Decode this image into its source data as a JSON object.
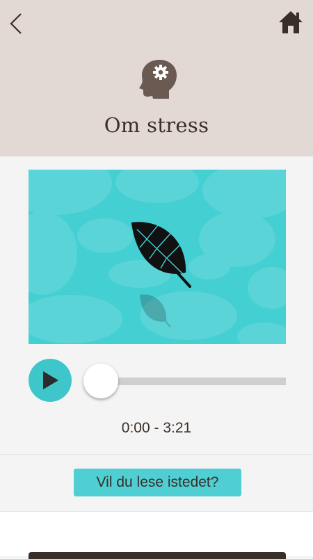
{
  "header": {
    "title": "Om stress",
    "back_icon": "chevron-left-icon",
    "home_icon": "home-icon",
    "topic_icon": "head-gear-icon",
    "background_color": "#e2d9d5"
  },
  "player": {
    "current_time": "0:00",
    "separator": " - ",
    "duration": "3:21",
    "progress": 0,
    "play_icon": "play-icon",
    "accent_color": "#3fc6cb",
    "video_illustration": "leaf-icon"
  },
  "read_button": {
    "label": "Vil du lese istedet?"
  },
  "colors": {
    "text": "#3a2e28",
    "page_background": "#f4f4f4"
  }
}
